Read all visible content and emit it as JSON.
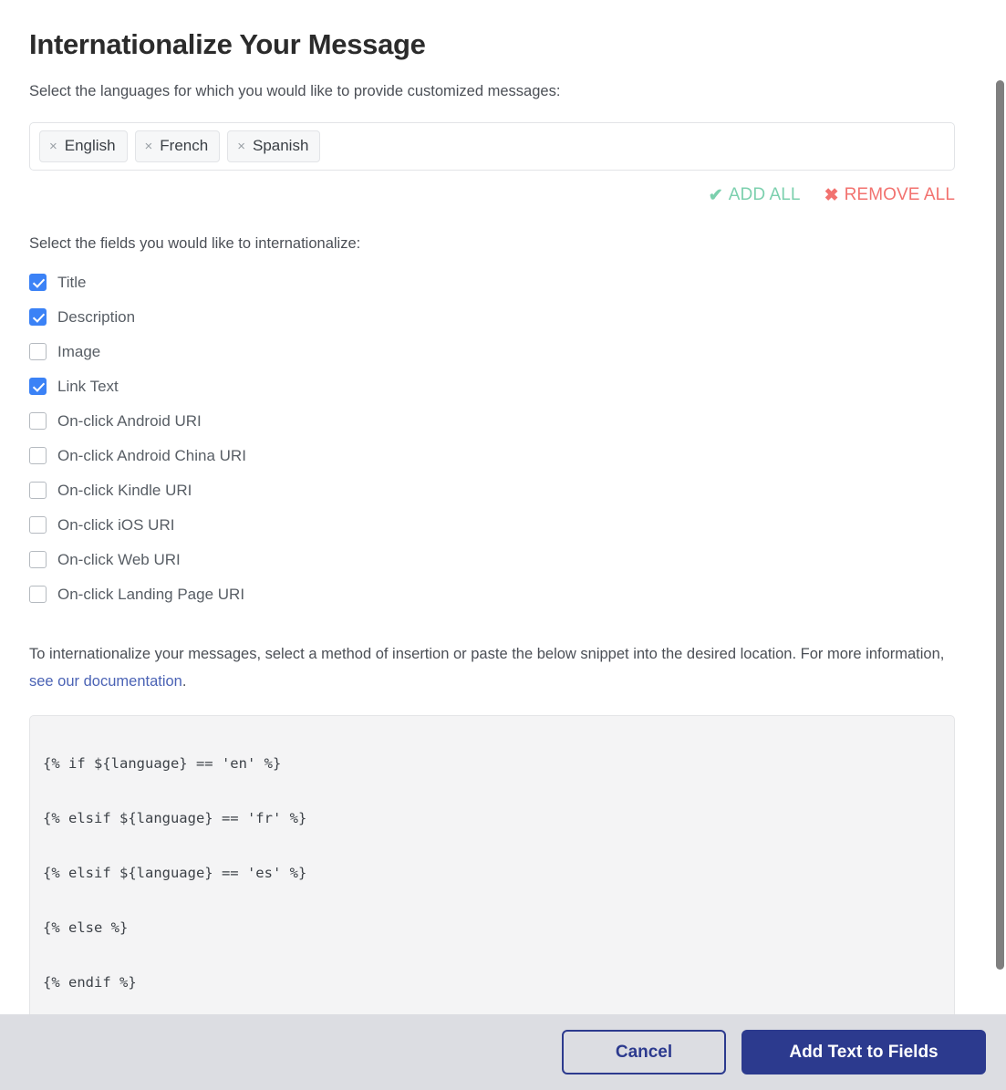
{
  "modal": {
    "title": "Internationalize Your Message",
    "languages_prompt": "Select the languages for which you would like to provide customized messages:",
    "fields_prompt": "Select the fields you would like to internationalize:"
  },
  "language_field": {
    "tokens": [
      {
        "label": "English",
        "remove_glyph": "×"
      },
      {
        "label": "French",
        "remove_glyph": "×"
      },
      {
        "label": "Spanish",
        "remove_glyph": "×"
      }
    ]
  },
  "bulk_actions": {
    "add_all": {
      "label": "ADD ALL",
      "glyph": "✔",
      "color": "#7cd0ae"
    },
    "remove_all": {
      "label": "REMOVE ALL",
      "glyph": "✖",
      "color": "#f2726f"
    }
  },
  "fields": [
    {
      "label": "Title",
      "checked": true
    },
    {
      "label": "Description",
      "checked": true
    },
    {
      "label": "Image",
      "checked": false
    },
    {
      "label": "Link Text",
      "checked": true
    },
    {
      "label": "On-click Android URI",
      "checked": false
    },
    {
      "label": "On-click Android China URI",
      "checked": false
    },
    {
      "label": "On-click Kindle URI",
      "checked": false
    },
    {
      "label": "On-click iOS URI",
      "checked": false
    },
    {
      "label": "On-click Web URI",
      "checked": false
    },
    {
      "label": "On-click Landing Page URI",
      "checked": false
    }
  ],
  "explanation": {
    "before_link": "To internationalize your messages, select a method of insertion or paste the below snippet into the desired location. For more information, ",
    "link_text": "see our documentation",
    "after_link": "."
  },
  "code_snippet": {
    "lines": [
      "{% if ${language} == 'en' %}",
      "{% elsif ${language} == 'fr' %}",
      "{% elsif ${language} == 'es' %}",
      "{% else %}",
      "{% endif %}"
    ]
  },
  "footer": {
    "cancel_label": "Cancel",
    "submit_label": "Add Text to Fields"
  },
  "colors": {
    "checkbox_checked": "#3b82f6",
    "primary_button": "#2c3a8e",
    "footer_background": "#dcdde2",
    "link": "#4b63b5",
    "code_background": "#f4f4f5"
  }
}
